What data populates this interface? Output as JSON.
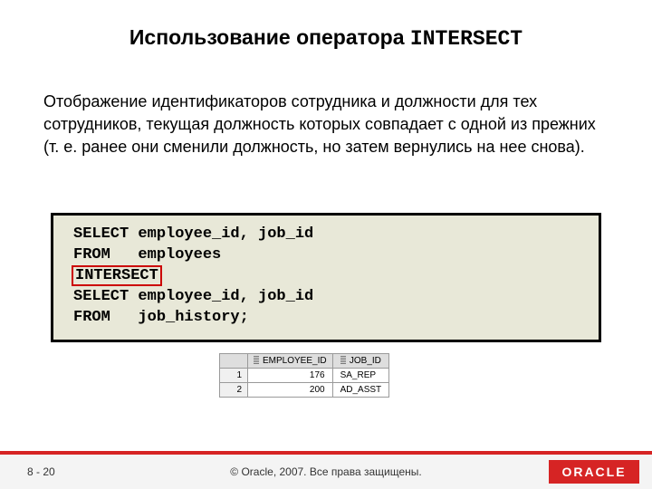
{
  "title": {
    "prefix": "Использование оператора ",
    "keyword": "INTERSECT"
  },
  "body_text": "Отображение идентификаторов сотрудника и должности для тех сотрудников, текущая должность которых совпадает с одной из прежних (т. е. ранее они сменили должность, но затем вернулись на нее снова).",
  "code": {
    "line1": "SELECT employee_id, job_id",
    "line2": "FROM   employees",
    "line3_hl": "INTERSECT",
    "line4": "SELECT employee_id, job_id",
    "line5": "FROM   job_history;"
  },
  "result": {
    "columns": [
      "EMPLOYEE_ID",
      "JOB_ID"
    ],
    "rows": [
      {
        "n": "1",
        "employee_id": "176",
        "job_id": "SA_REP"
      },
      {
        "n": "2",
        "employee_id": "200",
        "job_id": "AD_ASST"
      }
    ]
  },
  "footer": {
    "page": "8 - 20",
    "copyright": "© Oracle, 2007. Все права защищены.",
    "logo": "ORACLE"
  }
}
